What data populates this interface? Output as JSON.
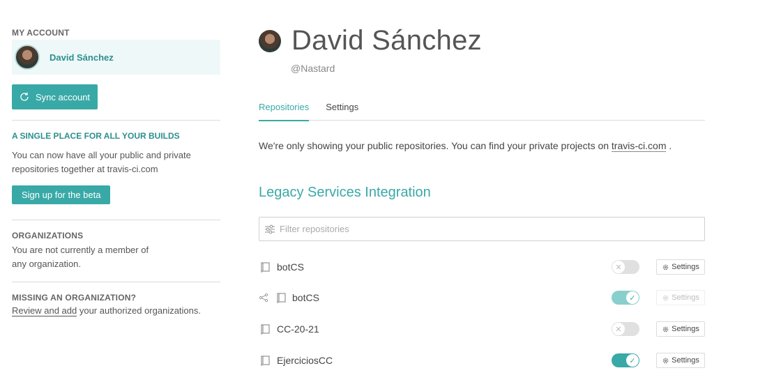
{
  "sidebar": {
    "account_title": "MY ACCOUNT",
    "account_name": "David Sánchez",
    "sync_label": "Sync account",
    "promo_title": "A SINGLE PLACE FOR ALL YOUR BUILDS",
    "promo_text": "You can now have all your public and private repositories together at travis-ci.com",
    "beta_label": "Sign up for the beta",
    "org_title": "ORGANIZATIONS",
    "org_text": "You are not currently a member of any organization.",
    "missing_title": "MISSING AN ORGANIZATION?",
    "missing_link": "Review and add",
    "missing_rest": " your authorized organizations."
  },
  "profile": {
    "name": "David Sánchez",
    "handle": "@Nastard"
  },
  "tabs": [
    {
      "label": "Repositories",
      "active": true
    },
    {
      "label": "Settings",
      "active": false
    }
  ],
  "notice": {
    "text": "We're only showing your public repositories. You can find your private projects on ",
    "link": "travis-ci.com",
    "end": " ."
  },
  "legacy_title": "Legacy Services Integration",
  "filter": {
    "placeholder": "Filter repositories"
  },
  "repos": [
    {
      "name": "botCS",
      "enabled": false,
      "fork": false,
      "settings_label": "Settings",
      "settings_enabled": true
    },
    {
      "name": "botCS",
      "enabled": true,
      "fork": true,
      "settings_label": "Settings",
      "settings_enabled": false
    },
    {
      "name": "CC-20-21",
      "enabled": false,
      "fork": false,
      "settings_label": "Settings",
      "settings_enabled": true
    },
    {
      "name": "EjerciciosCC",
      "enabled": true,
      "fork": false,
      "settings_label": "Settings",
      "settings_enabled": true
    }
  ],
  "colors": {
    "accent": "#39a9a7",
    "accent_dark": "#2d8f8f"
  }
}
